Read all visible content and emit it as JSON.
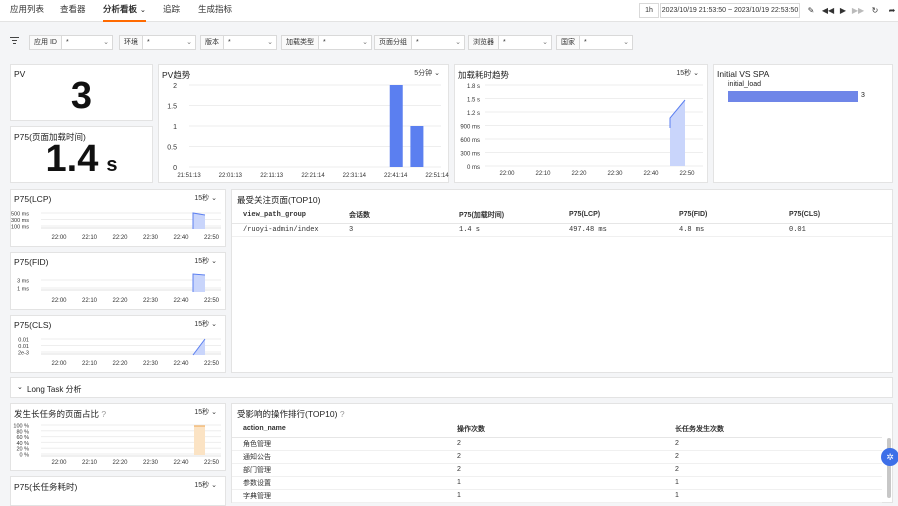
{
  "nav": {
    "tabs": [
      {
        "label": "应用列表"
      },
      {
        "label": "查看器"
      },
      {
        "label": "分析看板"
      },
      {
        "label": "追踪"
      },
      {
        "label": "生成指标"
      }
    ],
    "time_quick": "1h",
    "time_range": "2023/10/19 21:53:50 ~ 2023/10/19 22:53:50"
  },
  "filters": [
    {
      "label": "应用 ID",
      "value": "*"
    },
    {
      "label": "环境",
      "value": "*"
    },
    {
      "label": "版本",
      "value": "*"
    },
    {
      "label": "加载类型",
      "value": "*"
    },
    {
      "label": "页面分组",
      "value": "*"
    },
    {
      "label": "浏览器",
      "value": "*"
    },
    {
      "label": "国家",
      "value": "*"
    }
  ],
  "pv": {
    "title": "PV",
    "value": "3"
  },
  "p75_load": {
    "title": "P75(页面加载时间)",
    "value": "1.4",
    "unit": "s"
  },
  "pv_trend": {
    "title": "PV趋势",
    "interval": "5分钟",
    "chart_data": {
      "type": "bar",
      "x": [
        "21:51:13",
        "22:01:13",
        "22:11:13",
        "22:21:14",
        "22:31:14",
        "22:41:14",
        "22:51:14"
      ],
      "y_ticks": [
        "0",
        "0.5",
        "1",
        "1.5",
        "2"
      ],
      "ylim": [
        0,
        2
      ],
      "bars": [
        {
          "x": "22:41:14",
          "value": 2
        },
        {
          "x": "22:46:14",
          "value": 1
        }
      ],
      "color": "#5b7ff0"
    }
  },
  "load_trend": {
    "title": "加载耗时趋势",
    "interval": "15秒",
    "chart_data": {
      "type": "area",
      "x": [
        "22:00",
        "22:10",
        "22:20",
        "22:30",
        "22:40",
        "22:50"
      ],
      "y_ticks": [
        "0 ms",
        "300 ms",
        "600 ms",
        "900 ms",
        "1.2 s",
        "1.5 s",
        "1.8 s"
      ],
      "ylim": [
        0,
        1.8
      ],
      "color": "#5b7ff0"
    }
  },
  "initial_spa": {
    "title": "Initial VS SPA",
    "chart_data": {
      "type": "bar",
      "categories": [
        "initial_load"
      ],
      "values": [
        3
      ],
      "color": "#6f86e8"
    }
  },
  "lcp": {
    "title": "P75(LCP)",
    "interval": "15秒",
    "chart_data": {
      "type": "area",
      "y_ticks": [
        "500 ms",
        "300 ms",
        "100 ms"
      ],
      "x": [
        "22:00",
        "22:10",
        "22:20",
        "22:30",
        "22:40",
        "22:50"
      ]
    }
  },
  "fid": {
    "title": "P75(FID)",
    "interval": "15秒",
    "chart_data": {
      "type": "area",
      "y_ticks": [
        "3 ms",
        "1 ms"
      ],
      "x": [
        "22:00",
        "22:10",
        "22:20",
        "22:30",
        "22:40",
        "22:50"
      ]
    }
  },
  "cls": {
    "title": "P75(CLS)",
    "interval": "15秒",
    "chart_data": {
      "type": "area",
      "y_ticks": [
        "0.01",
        "0.01",
        "2e-3"
      ],
      "x": [
        "22:00",
        "22:10",
        "22:20",
        "22:30",
        "22:40",
        "22:50"
      ]
    }
  },
  "top_pages": {
    "title": "最受关注页面(TOP10)",
    "columns": [
      "view_path_group",
      "会话数",
      "P75(加载时间)",
      "P75(LCP)",
      "P75(FID)",
      "P75(CLS)"
    ],
    "rows": [
      [
        "/ruoyi-admin/index",
        "3",
        "1.4 s",
        "497.48 ms",
        "4.8 ms",
        "0.01"
      ]
    ]
  },
  "longtask": {
    "label": "Long Task 分析"
  },
  "longtask_ratio": {
    "title": "发生长任务的页面占比",
    "interval": "15秒",
    "chart_data": {
      "type": "bar",
      "y_ticks": [
        "100 %",
        "80 %",
        "60 %",
        "40 %",
        "20 %",
        "0 %"
      ],
      "x": [
        "22:00",
        "22:10",
        "22:20",
        "22:30",
        "22:40",
        "22:50"
      ]
    }
  },
  "longtask_p75": {
    "title": "P75(长任务耗时)",
    "interval": "15秒"
  },
  "actions": {
    "title": "受影响的操作排行(TOP10)",
    "columns": [
      "action_name",
      "操作次数",
      "长任务发生次数"
    ],
    "rows": [
      [
        "角色管理",
        "2",
        "2"
      ],
      [
        "通知公告",
        "2",
        "2"
      ],
      [
        "部门管理",
        "2",
        "2"
      ],
      [
        "参数设置",
        "1",
        "1"
      ],
      [
        "字典管理",
        "1",
        "1"
      ]
    ]
  }
}
